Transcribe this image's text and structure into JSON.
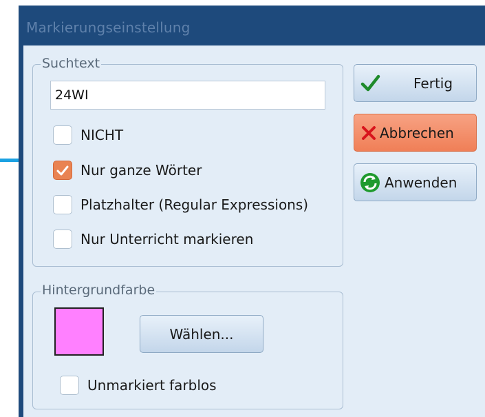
{
  "window": {
    "title": "Markierungseinstellung"
  },
  "search_group": {
    "legend": "Suchtext",
    "input_value": "24WI",
    "options": [
      {
        "label": "NICHT",
        "checked": false
      },
      {
        "label": "Nur ganze Wörter",
        "checked": true
      },
      {
        "label": "Platzhalter (Regular Expressions)",
        "checked": false
      },
      {
        "label": "Nur Unterricht markieren",
        "checked": false
      }
    ]
  },
  "background_group": {
    "legend": "Hintergrundfarbe",
    "color": "#ff80ff",
    "choose_label": "Wählen...",
    "unmarked_label": "Unmarkiert farblos",
    "unmarked_checked": false
  },
  "buttons": {
    "done": {
      "label": "Fertig",
      "icon": "checkmark-icon"
    },
    "cancel": {
      "label": "Abbrechen",
      "icon": "close-icon"
    },
    "apply": {
      "label": "Anwenden",
      "icon": "refresh-icon"
    }
  },
  "colors": {
    "title_bar": "#1e4a7c",
    "client_bg": "#e3edf7",
    "cancel_bg": "#f07f57",
    "accent": "#1ba1e2"
  }
}
